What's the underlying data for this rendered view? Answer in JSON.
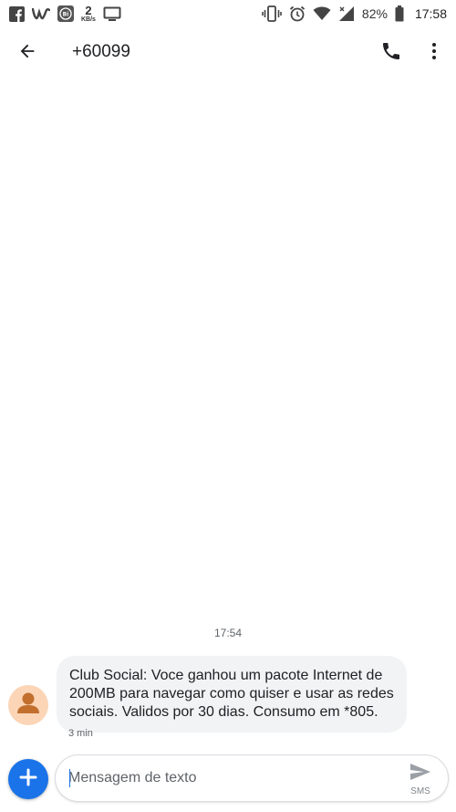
{
  "status_bar": {
    "network_speed_value": "2",
    "network_speed_unit": "KB/s",
    "battery_percent": "82%",
    "time": "17:58",
    "icons": [
      "facebook-icon",
      "w-app-icon",
      "bi-app-icon",
      "cast-icon",
      "vibrate-icon",
      "alarm-icon",
      "wifi-icon",
      "signal-icon",
      "battery-icon"
    ]
  },
  "app_bar": {
    "title": "+60099"
  },
  "conversation": {
    "timestamp": "17:54",
    "messages": [
      {
        "text": "Club Social: Voce ganhou um pacote Internet de 200MB para navegar como quiser e usar as redes sociais. Validos por 30 dias. Consumo em *805.",
        "time": "3 min"
      }
    ]
  },
  "compose": {
    "placeholder": "Mensagem de texto",
    "send_label": "SMS"
  },
  "colors": {
    "accent": "#1a73e8",
    "bubble": "#f1f3f4",
    "avatar_bg": "#fbd5b6",
    "avatar_fg": "#c26f2e"
  }
}
